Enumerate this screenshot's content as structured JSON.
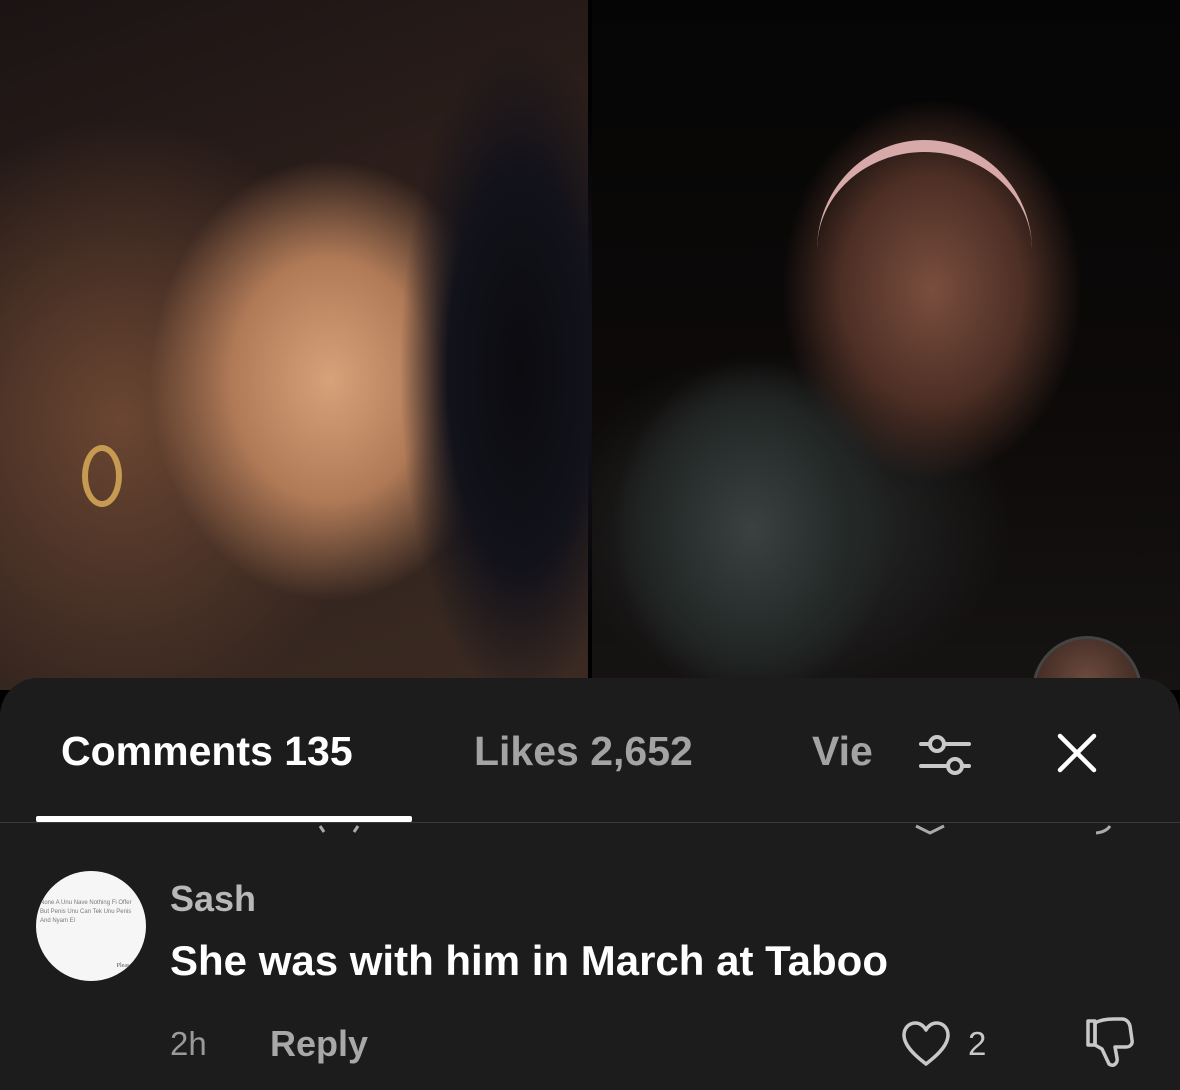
{
  "tabs": {
    "comments_label": "Comments 135",
    "likes_label": "Likes 2,652",
    "views_label": "Vie"
  },
  "icons": {
    "filter": "sliders-icon",
    "close": "close-icon",
    "like": "heart-outline-icon",
    "dislike": "thumbs-down-outline-icon"
  },
  "comment": {
    "avatar_text": "None A Unu Nave Nothing Fi Offer But Penis Unu Can Tek Unu Penis And Nyam El",
    "avatar_footer": "Please",
    "username": "Sash",
    "text": "She was with him in March at Taboo",
    "time": "2h",
    "reply_label": "Reply",
    "like_count": "2"
  },
  "colors": {
    "sheet_bg": "#1c1c1c",
    "active_tab": "#ffffff",
    "inactive_tab": "#a3a3a3"
  }
}
